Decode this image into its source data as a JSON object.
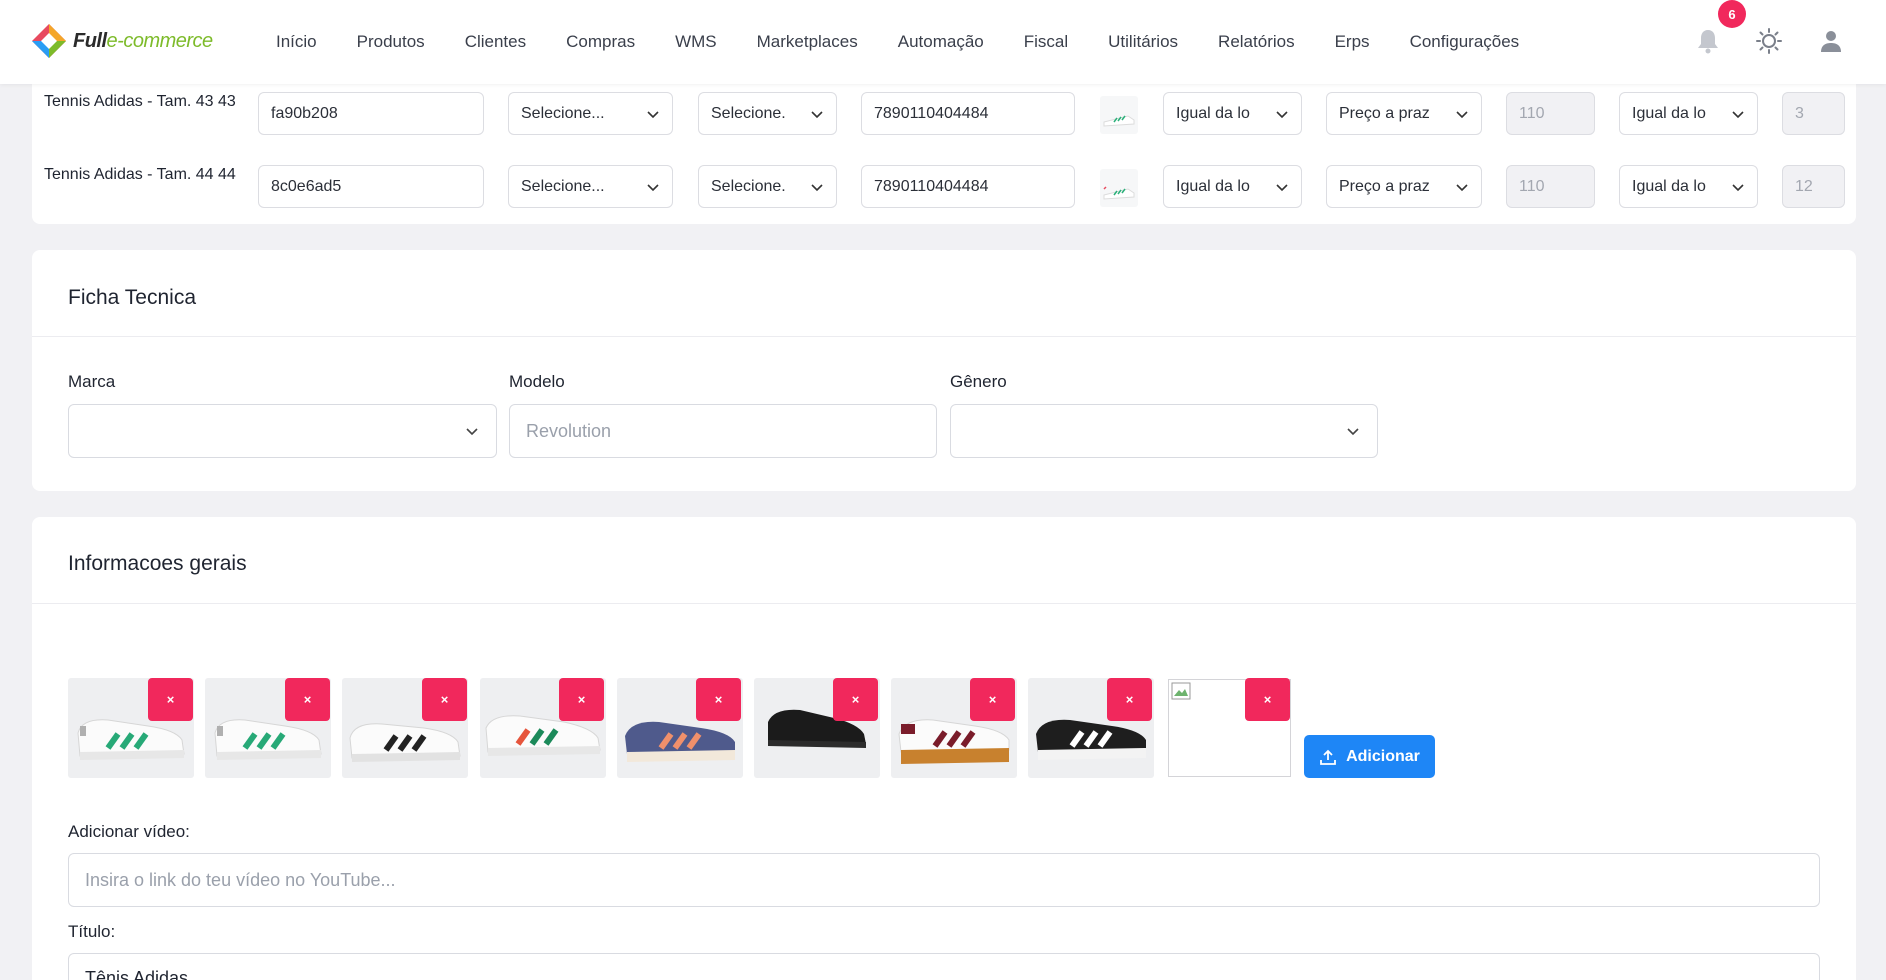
{
  "brand": {
    "logo_full": "Full",
    "logo_suffix": "e-commerce",
    "accent": "#1e86f6",
    "danger": "#f1285c"
  },
  "nav": {
    "items": [
      "Início",
      "Produtos",
      "Clientes",
      "Compras",
      "WMS",
      "Marketplaces",
      "Automação",
      "Fiscal",
      "Utilitários",
      "Relatórios",
      "Erps",
      "Configurações"
    ]
  },
  "header": {
    "notification_count": "6",
    "icons": [
      "bell-icon",
      "sun-icon",
      "user-icon"
    ]
  },
  "variants": [
    {
      "name": "Tennis Adidas - Tam. 43 43",
      "sku": "fa90b208",
      "select_1": "Selecione...",
      "select_2": "Selecione.",
      "ean": "7890110404484",
      "stock_mode": "Igual da lo",
      "price_type": "Preço a praz",
      "price_value": "110",
      "stock_mode_2": "Igual da lo",
      "quantity": "3"
    },
    {
      "name": "Tennis Adidas - Tam. 44 44",
      "sku": "8c0e6ad5",
      "select_1": "Selecione...",
      "select_2": "Selecione.",
      "ean": "7890110404484",
      "stock_mode": "Igual da lo",
      "price_type": "Preço a praz",
      "price_value": "110",
      "stock_mode_2": "Igual da lo",
      "quantity": "12"
    }
  ],
  "ficha": {
    "title": "Ficha Tecnica",
    "marca_label": "Marca",
    "marca_value": "",
    "modelo_label": "Modelo",
    "modelo_placeholder": "Revolution",
    "genero_label": "Gênero",
    "genero_value": ""
  },
  "info": {
    "title": "Informacoes gerais",
    "remove_glyph": "×",
    "add_button": "Adicionar",
    "video_label": "Adicionar vídeo:",
    "video_placeholder": "Insira o link do teu vídeo no YouTube...",
    "titulo_label": "Título:",
    "titulo_value": "Tênis Adidas"
  }
}
